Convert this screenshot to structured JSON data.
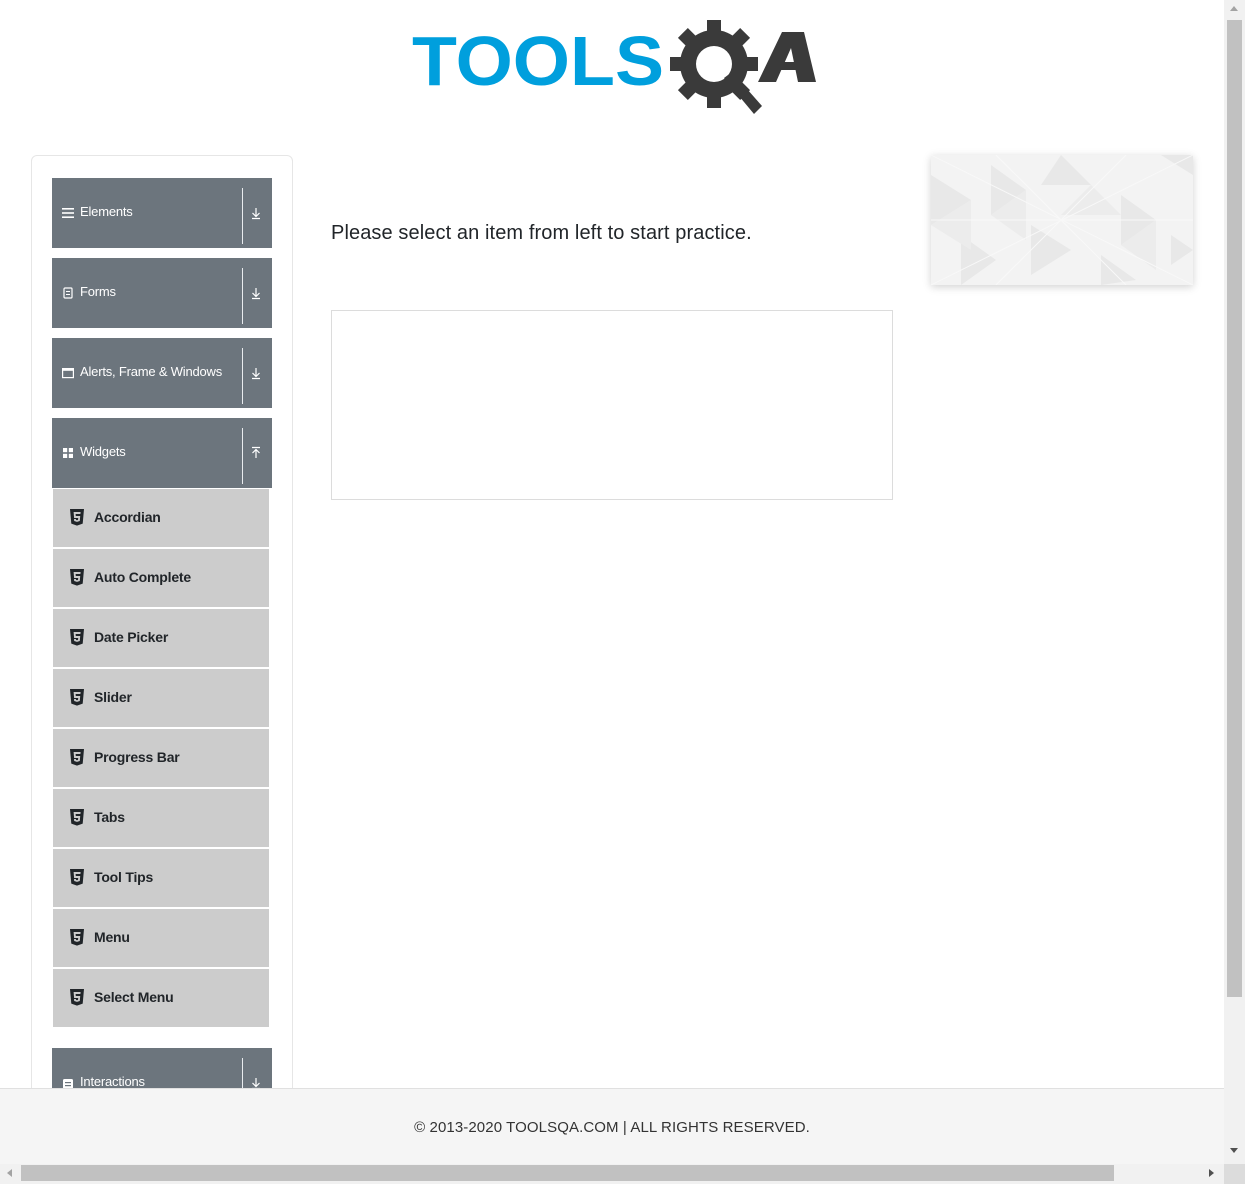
{
  "logo": {
    "text_primary": "TOOLS",
    "text_secondary": "QA",
    "primary_color": "#009fdd",
    "secondary_color": "#3a3a3a"
  },
  "sidebar": {
    "groups": [
      {
        "label": "Elements",
        "icon": "list-icon",
        "state": "collapsed"
      },
      {
        "label": "Forms",
        "icon": "form-icon",
        "state": "collapsed"
      },
      {
        "label": "Alerts, Frame & Windows",
        "icon": "window-icon",
        "state": "collapsed"
      },
      {
        "label": "Widgets",
        "icon": "grid-icon",
        "state": "expanded"
      },
      {
        "label": "Interactions",
        "icon": "interactions-icon",
        "state": "collapsed"
      }
    ],
    "widget_items": [
      {
        "label": "Accordian"
      },
      {
        "label": "Auto Complete"
      },
      {
        "label": "Date Picker"
      },
      {
        "label": "Slider"
      },
      {
        "label": "Progress Bar"
      },
      {
        "label": "Tabs"
      },
      {
        "label": "Tool Tips"
      },
      {
        "label": "Menu"
      },
      {
        "label": "Select Menu"
      }
    ],
    "header_color": "#6c757d",
    "item_color": "#cccccc"
  },
  "main": {
    "intro_text": "Please select an item from left to start practice."
  },
  "footer": {
    "text": "© 2013-2020 TOOLSQA.COM | ALL RIGHTS RESERVED."
  }
}
